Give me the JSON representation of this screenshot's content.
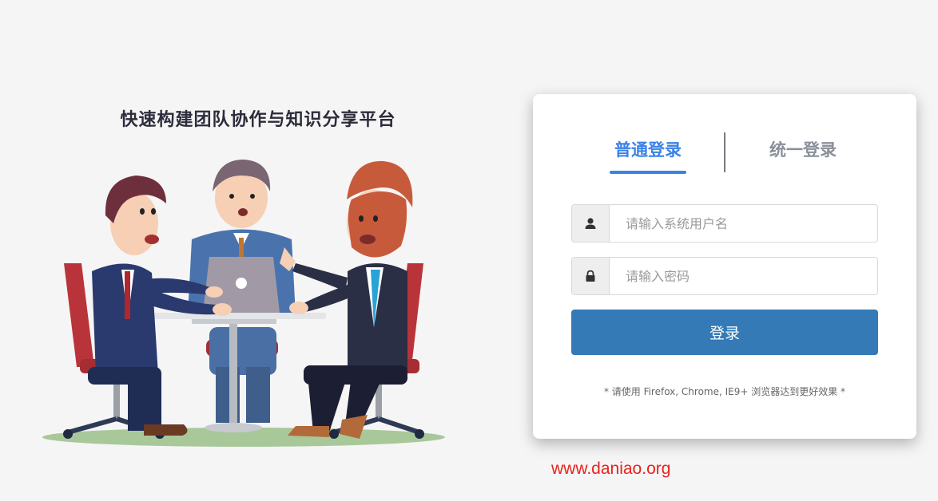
{
  "slogan": "快速构建团队协作与知识分享平台",
  "login": {
    "tabs": [
      {
        "label": "普通登录",
        "active": true
      },
      {
        "label": "统一登录",
        "active": false
      }
    ],
    "username": {
      "icon": "user-icon",
      "placeholder": "请输入系统用户名",
      "value": ""
    },
    "password": {
      "icon": "lock-icon",
      "placeholder": "请输入密码",
      "value": ""
    },
    "submit_label": "登录",
    "browser_tip": "* 请使用 Firefox, Chrome, IE9+ 浏览器达到更好效果 *"
  },
  "watermark": "www.daniao.org",
  "colors": {
    "accent": "#3b82e6",
    "button": "#337ab7",
    "watermark": "#e8231e",
    "background": "#f5f5f5"
  }
}
